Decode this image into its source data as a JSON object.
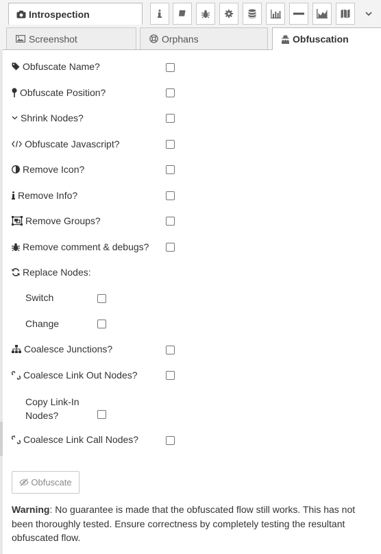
{
  "header": {
    "active_tab": "Introspection",
    "icons": [
      "info-icon",
      "book-icon",
      "bug-icon",
      "gear-icon",
      "database-icon",
      "bar-chart-icon",
      "minus-icon",
      "area-chart-icon",
      "map-icon"
    ]
  },
  "subtabs": [
    {
      "label": "Screenshot",
      "icon": "image-icon"
    },
    {
      "label": "Orphans",
      "icon": "life-ring-icon"
    },
    {
      "label": "Obfuscation",
      "icon": "user-secret-icon",
      "active": true
    }
  ],
  "options": {
    "obfuscate_name": "Obfuscate Name?",
    "obfuscate_position": "Obfuscate Position?",
    "shrink_nodes": "Shrink Nodes?",
    "obfuscate_javascript": "Obfuscate Javascript?",
    "remove_icon": "Remove Icon?",
    "remove_info": "Remove Info?",
    "remove_groups": "Remove Groups?",
    "remove_comments": "Remove comment & debugs?",
    "replace_nodes": "Replace Nodes:",
    "switch": "Switch",
    "change": "Change",
    "coalesce_junctions": "Coalesce Junctions?",
    "coalesce_link_out": "Coalesce Link Out Nodes?",
    "copy_link_in_1": "Copy Link-In",
    "copy_link_in_2": "Nodes?",
    "coalesce_link_call": "Coalesce Link Call Nodes?"
  },
  "button": {
    "label": "Obfuscate"
  },
  "warning": {
    "label": "Warning",
    "text": ": No guarantee is made that the obfuscated flow still works. This has not been thoroughly tested. Ensure correctness by completely testing the resultant obfuscated flow."
  },
  "colors": {
    "accent": "#333333",
    "tab_bg": "#f3f3f3",
    "border": "#bbbbbb"
  }
}
